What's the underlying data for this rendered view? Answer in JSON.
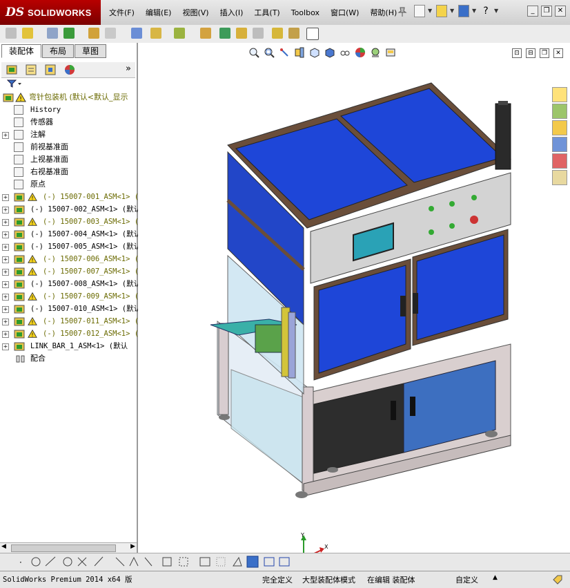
{
  "app": {
    "brand_ds": "DS",
    "brand_name": "SOLIDWORKS"
  },
  "menu": [
    "文件(F)",
    "编辑(E)",
    "视图(V)",
    "插入(I)",
    "工具(T)",
    "Toolbox",
    "窗口(W)",
    "帮助(H)"
  ],
  "tabs": [
    "装配体",
    "布局",
    "草图"
  ],
  "tree": {
    "root": "弯针包装机  (默认<默认_显示",
    "items": [
      {
        "label": "History",
        "icon": "history-icon",
        "mono": true
      },
      {
        "label": "传感器",
        "icon": "sensor-icon"
      },
      {
        "label": "注解",
        "icon": "annotation-icon",
        "expand": true
      },
      {
        "label": "前视基准面",
        "icon": "plane-icon"
      },
      {
        "label": "上视基准面",
        "icon": "plane-icon"
      },
      {
        "label": "右视基准面",
        "icon": "plane-icon"
      },
      {
        "label": "原点",
        "icon": "origin-icon"
      }
    ],
    "components": [
      {
        "label": "(-) 15007-001_ASM<1> (默认",
        "warn": true
      },
      {
        "label": "(-) 15007-002_ASM<1> (默认/",
        "warn": false
      },
      {
        "label": "(-) 15007-003_ASM<1> (默",
        "warn": true
      },
      {
        "label": "(-) 15007-004_ASM<1> (默认",
        "warn": false
      },
      {
        "label": "(-) 15007-005_ASM<1> (默认",
        "warn": false
      },
      {
        "label": "(-) 15007-006_ASM<1> (默",
        "warn": true
      },
      {
        "label": "(-) 15007-007_ASM<1> (默",
        "warn": true
      },
      {
        "label": "(-) 15007-008_ASM<1> (默认",
        "warn": false
      },
      {
        "label": "(-) 15007-009_ASM<1> (默",
        "warn": true
      },
      {
        "label": "(-) 15007-010_ASM<1> (默认",
        "warn": false
      },
      {
        "label": "(-) 15007-011_ASM<1> (默",
        "warn": true
      },
      {
        "label": "(-) 15007-012_ASM<1> (默",
        "warn": true
      },
      {
        "label": "LINK_BAR_1_ASM<1> (默认",
        "warn": false
      }
    ],
    "mates": "配合"
  },
  "status": {
    "product": "SolidWorks Premium 2014 x64 版",
    "defined": "完全定义",
    "mode": "大型装配体模式",
    "editing": "在编辑 装配体",
    "custom": "自定义"
  },
  "triad": {
    "x": "X",
    "y": "Y",
    "z": "Z"
  }
}
